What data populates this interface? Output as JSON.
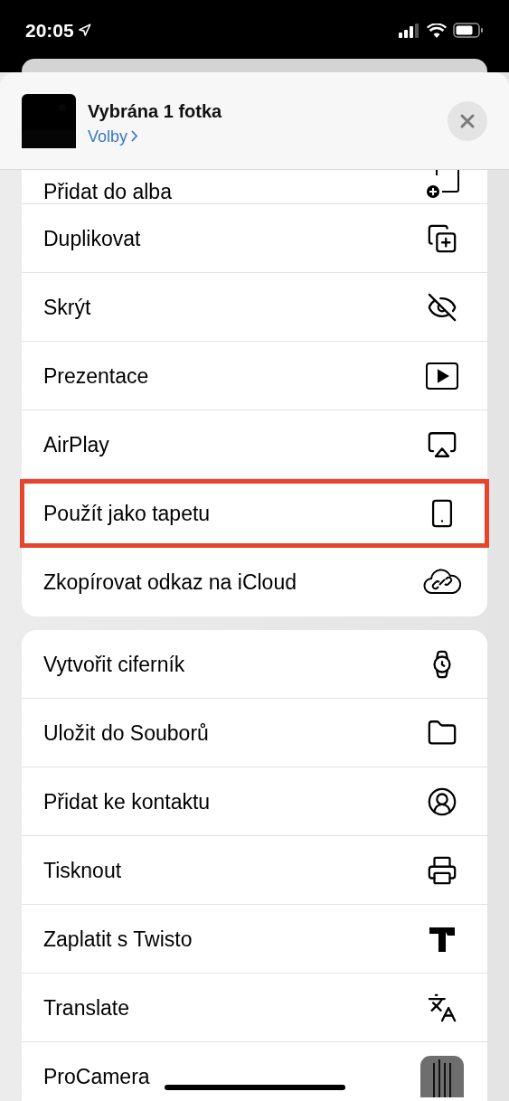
{
  "status_bar": {
    "time": "20:05"
  },
  "header": {
    "title": "Vybrána 1 fotka",
    "options_link": "Volby"
  },
  "groups": [
    {
      "items": [
        {
          "label": "Přidat do alba",
          "highlighted": false,
          "clipped": true
        },
        {
          "label": "Duplikovat",
          "highlighted": false,
          "clipped": false
        },
        {
          "label": "Skrýt",
          "highlighted": false,
          "clipped": false
        },
        {
          "label": "Prezentace",
          "highlighted": false,
          "clipped": false
        },
        {
          "label": "AirPlay",
          "highlighted": false,
          "clipped": false
        },
        {
          "label": "Použít jako tapetu",
          "highlighted": true,
          "clipped": false
        },
        {
          "label": "Zkopírovat odkaz na iCloud",
          "highlighted": false,
          "clipped": false
        }
      ]
    },
    {
      "items": [
        {
          "label": "Vytvořit ciferník",
          "highlighted": false,
          "clipped": false
        },
        {
          "label": "Uložit do Souborů",
          "highlighted": false,
          "clipped": false
        },
        {
          "label": "Přidat ke kontaktu",
          "highlighted": false,
          "clipped": false
        },
        {
          "label": "Tisknout",
          "highlighted": false,
          "clipped": false
        },
        {
          "label": "Zaplatit s Twisto",
          "highlighted": false,
          "clipped": false
        },
        {
          "label": "Translate",
          "highlighted": false,
          "clipped": false
        },
        {
          "label": "ProCamera",
          "highlighted": false,
          "clipped": false
        }
      ]
    }
  ]
}
